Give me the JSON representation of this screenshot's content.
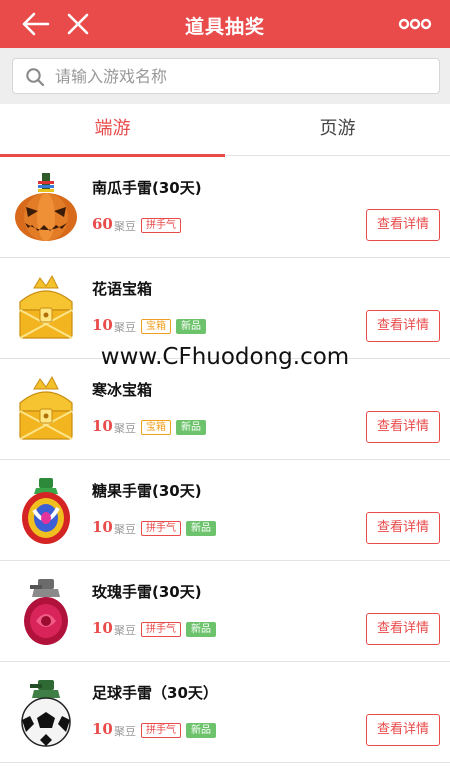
{
  "header": {
    "title": "道具抽奖",
    "back_icon": "back-arrow-icon",
    "close_icon": "close-icon",
    "more_icon": "more-dots-icon",
    "color": "#e94b4b"
  },
  "search": {
    "placeholder": "请输入游戏名称",
    "value": "",
    "icon": "search-icon"
  },
  "tabs": [
    {
      "label": "端游",
      "active": true
    },
    {
      "label": "页游",
      "active": false
    }
  ],
  "items": [
    {
      "name": "南瓜手雷(30天)",
      "price": "60",
      "unit": "聚豆",
      "tags": [
        {
          "text": "拼手气",
          "style": "red"
        }
      ],
      "button": "查看详情",
      "icon": "pumpkin-grenade-icon"
    },
    {
      "name": "花语宝箱",
      "price": "10",
      "unit": "聚豆",
      "tags": [
        {
          "text": "宝箱",
          "style": "orange"
        },
        {
          "text": "新品",
          "style": "green"
        }
      ],
      "button": "查看详情",
      "icon": "gold-treasure-chest-icon"
    },
    {
      "name": "寒冰宝箱",
      "price": "10",
      "unit": "聚豆",
      "tags": [
        {
          "text": "宝箱",
          "style": "orange"
        },
        {
          "text": "新品",
          "style": "green"
        }
      ],
      "button": "查看详情",
      "icon": "gold-treasure-chest-icon"
    },
    {
      "name": "糖果手雷(30天)",
      "price": "10",
      "unit": "聚豆",
      "tags": [
        {
          "text": "拼手气",
          "style": "red"
        },
        {
          "text": "新品",
          "style": "green"
        }
      ],
      "button": "查看详情",
      "icon": "candy-grenade-icon"
    },
    {
      "name": "玫瑰手雷(30天)",
      "price": "10",
      "unit": "聚豆",
      "tags": [
        {
          "text": "拼手气",
          "style": "red"
        },
        {
          "text": "新品",
          "style": "green"
        }
      ],
      "button": "查看详情",
      "icon": "rose-grenade-icon"
    },
    {
      "name": "足球手雷（30天）",
      "price": "10",
      "unit": "聚豆",
      "tags": [
        {
          "text": "拼手气",
          "style": "red"
        },
        {
          "text": "新品",
          "style": "green"
        }
      ],
      "button": "查看详情",
      "icon": "soccer-grenade-icon"
    }
  ],
  "watermark": "www.CFhuodong.com"
}
